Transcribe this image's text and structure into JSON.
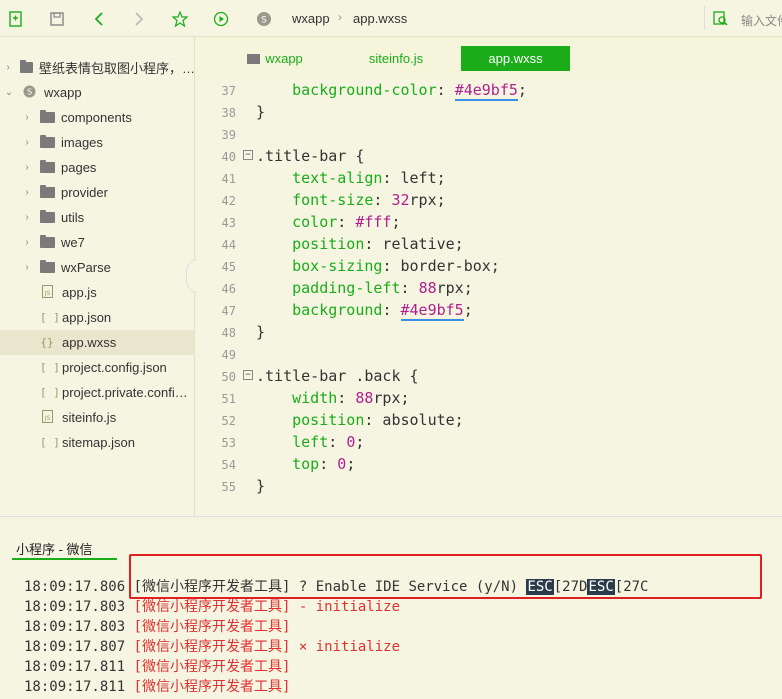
{
  "toolbar": {
    "breadcrumb": [
      "wxapp",
      "app.wxss"
    ],
    "search_placeholder": "输入文件"
  },
  "sidebar": {
    "items": [
      {
        "label": "壁纸表情包取图小程序，…",
        "type": "folder",
        "level": 0,
        "expanded": false
      },
      {
        "label": "wxapp",
        "type": "project",
        "level": 0,
        "expanded": true
      },
      {
        "label": "components",
        "type": "folder",
        "level": 1
      },
      {
        "label": "images",
        "type": "folder",
        "level": 1
      },
      {
        "label": "pages",
        "type": "folder",
        "level": 1
      },
      {
        "label": "provider",
        "type": "folder",
        "level": 1
      },
      {
        "label": "utils",
        "type": "folder",
        "level": 1
      },
      {
        "label": "we7",
        "type": "folder",
        "level": 1
      },
      {
        "label": "wxParse",
        "type": "folder",
        "level": 1
      },
      {
        "label": "app.js",
        "type": "js",
        "level": 1
      },
      {
        "label": "app.json",
        "type": "json",
        "level": 1
      },
      {
        "label": "app.wxss",
        "type": "wxss",
        "level": 1,
        "active": true
      },
      {
        "label": "project.config.json",
        "type": "json",
        "level": 1
      },
      {
        "label": "project.private.confi…",
        "type": "json",
        "level": 1
      },
      {
        "label": "siteinfo.js",
        "type": "js",
        "level": 1
      },
      {
        "label": "sitemap.json",
        "type": "json",
        "level": 1
      }
    ]
  },
  "tabs": [
    {
      "label": "wxapp",
      "active": false
    },
    {
      "label": "siteinfo.js",
      "active": false
    },
    {
      "label": "app.wxss",
      "active": true
    }
  ],
  "editor": {
    "lines": [
      {
        "n": "37",
        "text": "    background-color: #4e9bf5;"
      },
      {
        "n": "38",
        "text": "}"
      },
      {
        "n": "39",
        "text": ""
      },
      {
        "n": "40",
        "text": ".title-bar {",
        "fold": true
      },
      {
        "n": "41",
        "text": "    text-align: left;"
      },
      {
        "n": "42",
        "text": "    font-size: 32rpx;"
      },
      {
        "n": "43",
        "text": "    color: #fff;"
      },
      {
        "n": "44",
        "text": "    position: relative;"
      },
      {
        "n": "45",
        "text": "    box-sizing: border-box;"
      },
      {
        "n": "46",
        "text": "    padding-left: 88rpx;"
      },
      {
        "n": "47",
        "text": "    background: #4e9bf5;"
      },
      {
        "n": "48",
        "text": "}"
      },
      {
        "n": "49",
        "text": ""
      },
      {
        "n": "50",
        "text": ".title-bar .back {",
        "fold": true
      },
      {
        "n": "51",
        "text": "    width: 88rpx;"
      },
      {
        "n": "52",
        "text": "    position: absolute;"
      },
      {
        "n": "53",
        "text": "    left: 0;"
      },
      {
        "n": "54",
        "text": "    top: 0;"
      },
      {
        "n": "55",
        "text": "}"
      }
    ]
  },
  "console": {
    "tab_label": "小程序 - 微信",
    "logs": [
      {
        "time": "18:09:17.806",
        "tag": "[微信小程序开发者工具]",
        "msg": " ? Enable IDE Service (y/N) ",
        "esc1": "ESC",
        "mid": "[27D",
        "esc2": "ESC",
        "tail": "[27C",
        "red": false
      },
      {
        "time": "18:09:17.803",
        "tag": "[微信小程序开发者工具]",
        "msg": " - initialize",
        "red": true
      },
      {
        "time": "18:09:17.803",
        "tag": "[微信小程序开发者工具]",
        "msg": "",
        "red": true
      },
      {
        "time": "18:09:17.807",
        "tag": "[微信小程序开发者工具]",
        "msg": " × initialize",
        "red": true
      },
      {
        "time": "18:09:17.811",
        "tag": "[微信小程序开发者工具]",
        "msg": "",
        "red": true
      },
      {
        "time": "18:09:17.811",
        "tag": "[微信小程序开发者工具]",
        "msg": "",
        "red": true
      }
    ]
  },
  "colors": {
    "accent": "#1aad19",
    "highlight_box": "#e02020",
    "hex_value": "#4e9bf5"
  }
}
